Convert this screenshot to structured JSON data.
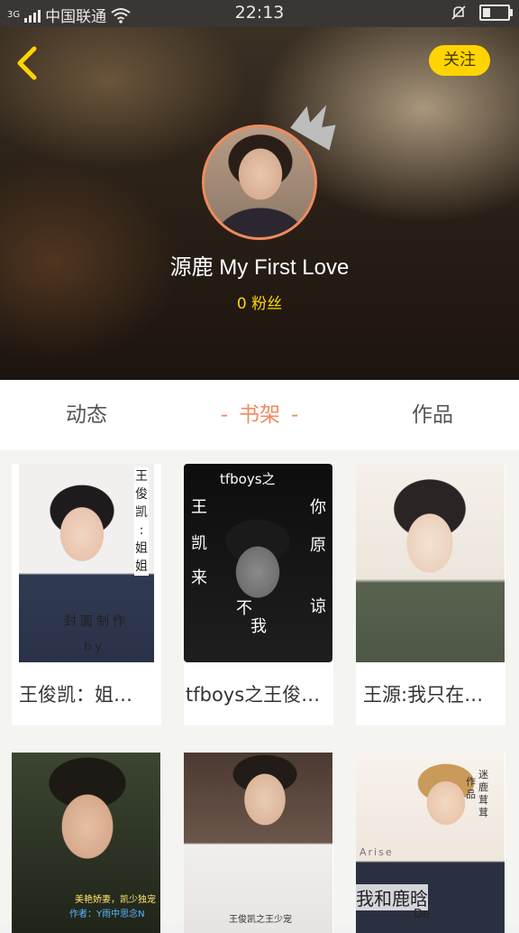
{
  "status_bar": {
    "network": "3G",
    "carrier": "中国联通",
    "time": "22:13"
  },
  "header": {
    "back_icon": "chevron-left-icon",
    "follow_label": "关注",
    "username": "源鹿 My First Love",
    "fans": "0 粉丝"
  },
  "tabs": [
    {
      "label": "动态",
      "active": false
    },
    {
      "label": "书架",
      "active": true
    },
    {
      "label": "作品",
      "active": false
    }
  ],
  "active_tab_dash": "-",
  "books": [
    {
      "title": "王俊凯：姐…",
      "cover_text": [
        "王",
        "俊",
        "凯",
        ":",
        "姐",
        "姐"
      ],
      "cover_overlay": "封面制作",
      "cover_by": "by"
    },
    {
      "title": "tfboys之王俊…",
      "cover_text_top": "tfboys之",
      "cover_chars": [
        "王",
        "凯",
        "来",
        "不",
        "我",
        "你",
        "原",
        "谅"
      ]
    },
    {
      "title": "王源:我只在…"
    },
    {
      "title": "",
      "cover_caption_1": "美艳娇妻，凯少独宠",
      "cover_caption_2": "作者：Y雨中思念N"
    },
    {
      "title": "",
      "cover_caption": "王俊凯之王少宠"
    },
    {
      "title": "",
      "cover_big": "我和鹿晗",
      "cover_de": "De",
      "cover_small": "Arise",
      "cover_side": [
        "迷",
        "鹿",
        "茸",
        "茸",
        "作",
        "品"
      ]
    }
  ],
  "colors": {
    "accent": "#f08a5d",
    "follow_bg": "#ffd400",
    "fans": "#ffd400"
  }
}
